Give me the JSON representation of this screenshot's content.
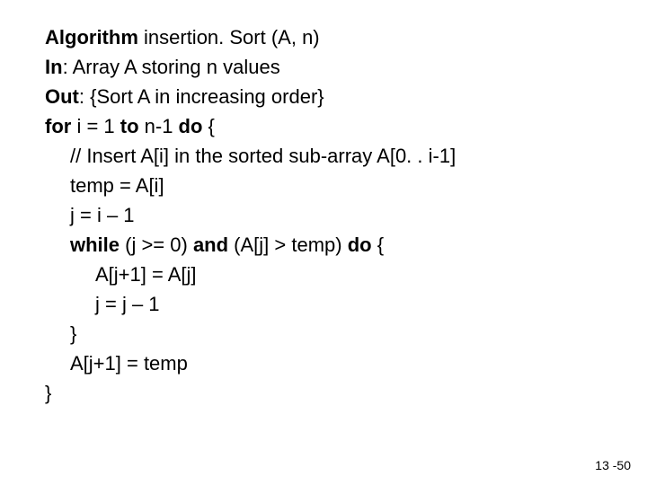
{
  "algorithm": {
    "line1_kw": "Algorithm",
    "line1_rest": " insertion. Sort (A, n)",
    "line2_kw": "In",
    "line2_rest": ": Array A storing n values",
    "line3_kw": "Out",
    "line3_rest": ": {Sort A in increasing order}",
    "line4_kw1": "for",
    "line4_mid": " i = 1 ",
    "line4_kw2": "to",
    "line4_mid2": " n-1 ",
    "line4_kw3": "do",
    "line4_rest": " {",
    "line5": "// Insert A[i] in the sorted sub-array A[0. . i-1]",
    "line6": "temp = A[i]",
    "line7": "j = i – 1",
    "line8_kw1": "while",
    "line8_mid1": " (j >= 0) ",
    "line8_kw2": "and",
    "line8_mid2": " (A[j] > temp) ",
    "line8_kw3": "do",
    "line8_rest": " {",
    "line9": "A[j+1] = A[j]",
    "line10": "j = j – 1",
    "line11": "}",
    "line12": "A[j+1] = temp",
    "line13": "}"
  },
  "page_number": "13 -50"
}
